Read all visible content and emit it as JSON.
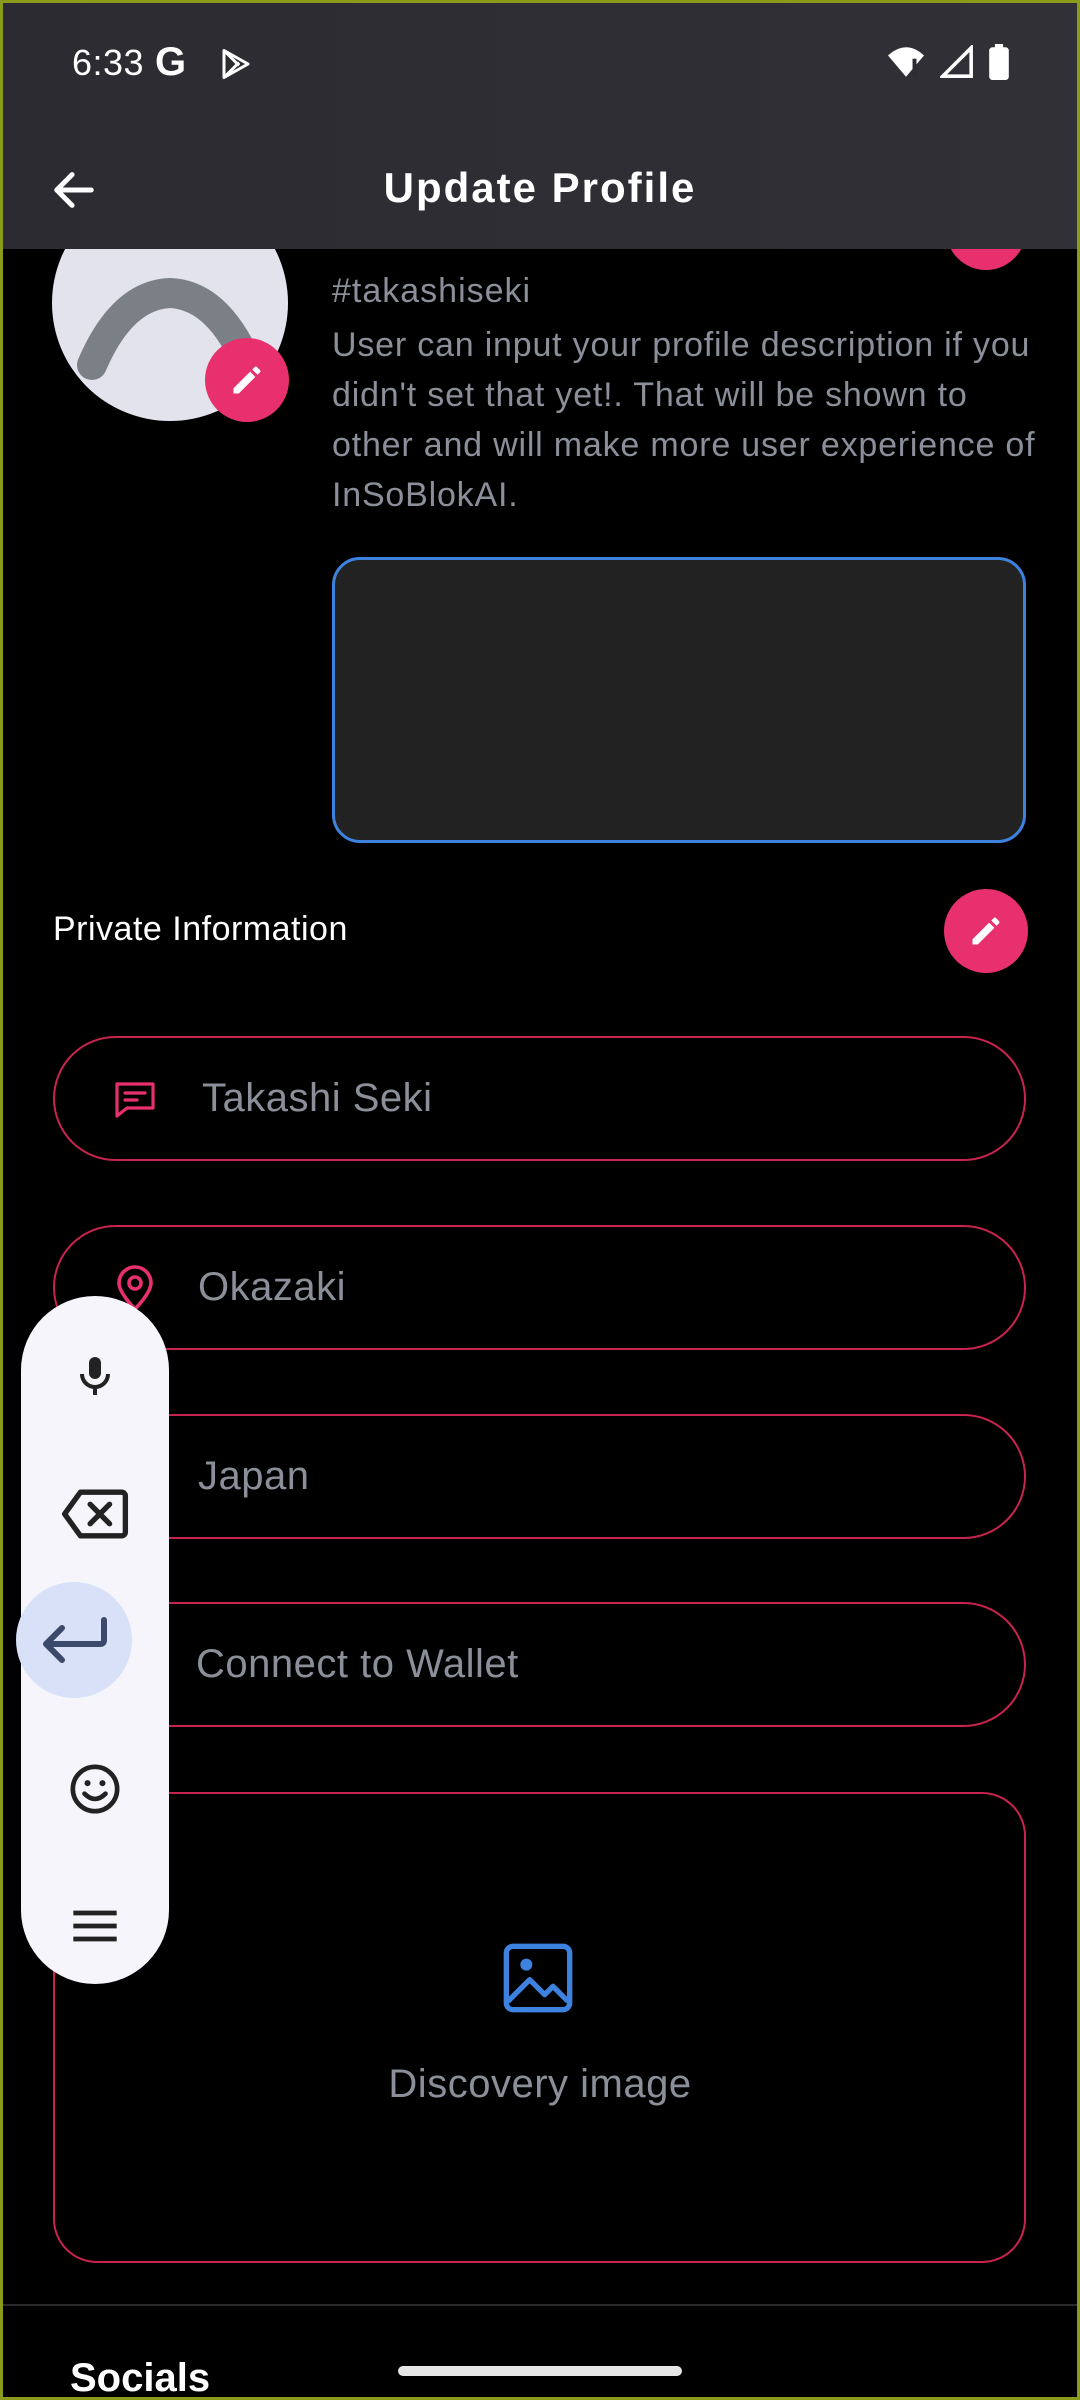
{
  "status_bar": {
    "time": "6:33",
    "g_logo": "G"
  },
  "app_bar": {
    "title": "Update Profile",
    "back_icon": "arrow-left-icon"
  },
  "profile": {
    "handle": "#takashiseki",
    "description": "User can input your profile description if you didn't set that yet!. That will be shown to other and will make more user experience of InSoBlokAI.",
    "description_input_value": ""
  },
  "private_info": {
    "title": "Private Information",
    "fields": [
      {
        "icon": "message-icon",
        "value": "Takashi Seki"
      },
      {
        "icon": "location-pin-icon",
        "value": "Okazaki"
      },
      {
        "icon": "flag-icon",
        "value": "Japan"
      },
      {
        "icon": "wallet-icon",
        "value": "Connect to Wallet"
      }
    ],
    "image_label": "Discovery image"
  },
  "socials": {
    "title": "Socials"
  },
  "keyboard_toolbar": {
    "items": [
      "microphone-icon",
      "backspace-icon",
      "enter-icon",
      "emoji-icon",
      "menu-icon"
    ]
  },
  "colors": {
    "accent": "#e8306f",
    "field_border": "#c8244e",
    "focus_border": "#3e82e0",
    "muted_text": "#8b8f99"
  }
}
